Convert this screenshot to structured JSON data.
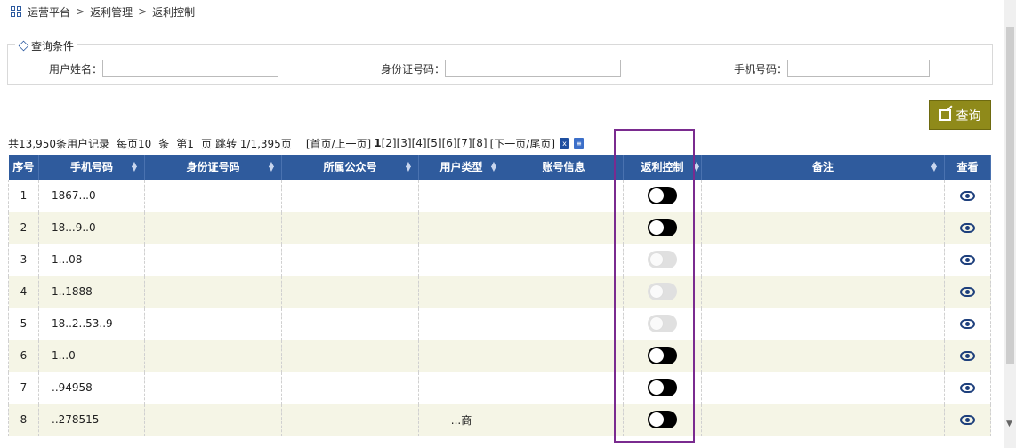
{
  "breadcrumb": {
    "icon": "grid-icon",
    "items": [
      "运营平台",
      "返利管理",
      "返利控制"
    ],
    "separator": ">"
  },
  "query": {
    "legend": "查询条件",
    "fields": [
      {
        "label": "用户姓名：",
        "value": "",
        "placeholder": ""
      },
      {
        "label": "身份证号码：",
        "value": "",
        "placeholder": ""
      },
      {
        "label": "手机号码：",
        "value": "",
        "placeholder": ""
      }
    ],
    "search_label": "查询"
  },
  "pager": {
    "total_text": "共13,950条用户记录",
    "per_page_text": "每页10",
    "item_unit": "条",
    "page_text": "第1",
    "page_unit": "页",
    "jump_text": "跳转 1/1,395页",
    "first_prev": "[首页/上一页]",
    "pages": [
      "1",
      "[2]",
      "[3]",
      "[4]",
      "[5]",
      "[6]",
      "[7]",
      "[8]"
    ],
    "next_last": "[下一页/尾页]"
  },
  "table": {
    "headers": [
      "序号",
      "手机号码",
      "身份证号码",
      "所属公众号",
      "用户类型",
      "账号信息",
      "返利控制",
      "备注",
      "查看"
    ],
    "rows": [
      {
        "no": "1",
        "phone": "1867...0",
        "id_card": "",
        "account": "",
        "type": "",
        "info": "",
        "rebate_on": true,
        "note": ""
      },
      {
        "no": "2",
        "phone": "18...9..0",
        "id_card": "",
        "account": "",
        "type": "",
        "info": "",
        "rebate_on": true,
        "note": ""
      },
      {
        "no": "3",
        "phone": "1...08",
        "id_card": "",
        "account": "",
        "type": "",
        "info": "",
        "rebate_on": false,
        "note": ""
      },
      {
        "no": "4",
        "phone": "1..1888",
        "id_card": "",
        "account": "",
        "type": "",
        "info": "",
        "rebate_on": false,
        "note": ""
      },
      {
        "no": "5",
        "phone": "18..2..53..9",
        "id_card": "",
        "account": "",
        "type": "",
        "info": "",
        "rebate_on": false,
        "note": ""
      },
      {
        "no": "6",
        "phone": "1...0",
        "id_card": "",
        "account": "",
        "type": "",
        "info": "",
        "rebate_on": true,
        "note": ""
      },
      {
        "no": "7",
        "phone": "..94958",
        "id_card": "",
        "account": "",
        "type": "",
        "info": "",
        "rebate_on": true,
        "note": ""
      },
      {
        "no": "8",
        "phone": "..278515",
        "id_card": "",
        "account": "",
        "type": "...商",
        "info": "",
        "rebate_on": true,
        "note": ""
      }
    ]
  },
  "colors": {
    "header_bg": "#2f5b9d",
    "alt_row_bg": "#f5f5e6",
    "search_button_bg": "#8f8a1a",
    "highlight_border": "#7a2b8f",
    "toggle_on": "#000000",
    "toggle_off": "#e0e0e0"
  }
}
